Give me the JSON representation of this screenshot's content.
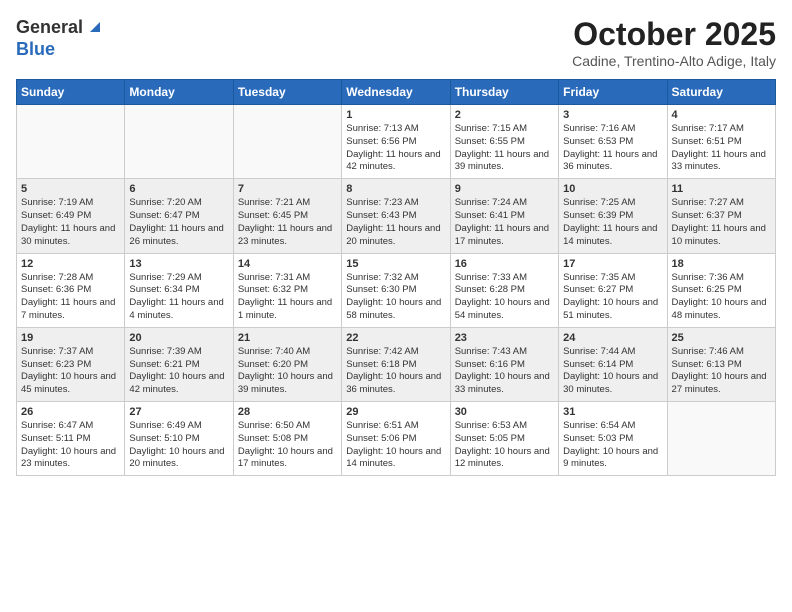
{
  "header": {
    "logo_general": "General",
    "logo_blue": "Blue",
    "month_title": "October 2025",
    "subtitle": "Cadine, Trentino-Alto Adige, Italy"
  },
  "days_of_week": [
    "Sunday",
    "Monday",
    "Tuesday",
    "Wednesday",
    "Thursday",
    "Friday",
    "Saturday"
  ],
  "weeks": [
    [
      {
        "day": "",
        "info": ""
      },
      {
        "day": "",
        "info": ""
      },
      {
        "day": "",
        "info": ""
      },
      {
        "day": "1",
        "info": "Sunrise: 7:13 AM\nSunset: 6:56 PM\nDaylight: 11 hours and 42 minutes."
      },
      {
        "day": "2",
        "info": "Sunrise: 7:15 AM\nSunset: 6:55 PM\nDaylight: 11 hours and 39 minutes."
      },
      {
        "day": "3",
        "info": "Sunrise: 7:16 AM\nSunset: 6:53 PM\nDaylight: 11 hours and 36 minutes."
      },
      {
        "day": "4",
        "info": "Sunrise: 7:17 AM\nSunset: 6:51 PM\nDaylight: 11 hours and 33 minutes."
      }
    ],
    [
      {
        "day": "5",
        "info": "Sunrise: 7:19 AM\nSunset: 6:49 PM\nDaylight: 11 hours and 30 minutes."
      },
      {
        "day": "6",
        "info": "Sunrise: 7:20 AM\nSunset: 6:47 PM\nDaylight: 11 hours and 26 minutes."
      },
      {
        "day": "7",
        "info": "Sunrise: 7:21 AM\nSunset: 6:45 PM\nDaylight: 11 hours and 23 minutes."
      },
      {
        "day": "8",
        "info": "Sunrise: 7:23 AM\nSunset: 6:43 PM\nDaylight: 11 hours and 20 minutes."
      },
      {
        "day": "9",
        "info": "Sunrise: 7:24 AM\nSunset: 6:41 PM\nDaylight: 11 hours and 17 minutes."
      },
      {
        "day": "10",
        "info": "Sunrise: 7:25 AM\nSunset: 6:39 PM\nDaylight: 11 hours and 14 minutes."
      },
      {
        "day": "11",
        "info": "Sunrise: 7:27 AM\nSunset: 6:37 PM\nDaylight: 11 hours and 10 minutes."
      }
    ],
    [
      {
        "day": "12",
        "info": "Sunrise: 7:28 AM\nSunset: 6:36 PM\nDaylight: 11 hours and 7 minutes."
      },
      {
        "day": "13",
        "info": "Sunrise: 7:29 AM\nSunset: 6:34 PM\nDaylight: 11 hours and 4 minutes."
      },
      {
        "day": "14",
        "info": "Sunrise: 7:31 AM\nSunset: 6:32 PM\nDaylight: 11 hours and 1 minute."
      },
      {
        "day": "15",
        "info": "Sunrise: 7:32 AM\nSunset: 6:30 PM\nDaylight: 10 hours and 58 minutes."
      },
      {
        "day": "16",
        "info": "Sunrise: 7:33 AM\nSunset: 6:28 PM\nDaylight: 10 hours and 54 minutes."
      },
      {
        "day": "17",
        "info": "Sunrise: 7:35 AM\nSunset: 6:27 PM\nDaylight: 10 hours and 51 minutes."
      },
      {
        "day": "18",
        "info": "Sunrise: 7:36 AM\nSunset: 6:25 PM\nDaylight: 10 hours and 48 minutes."
      }
    ],
    [
      {
        "day": "19",
        "info": "Sunrise: 7:37 AM\nSunset: 6:23 PM\nDaylight: 10 hours and 45 minutes."
      },
      {
        "day": "20",
        "info": "Sunrise: 7:39 AM\nSunset: 6:21 PM\nDaylight: 10 hours and 42 minutes."
      },
      {
        "day": "21",
        "info": "Sunrise: 7:40 AM\nSunset: 6:20 PM\nDaylight: 10 hours and 39 minutes."
      },
      {
        "day": "22",
        "info": "Sunrise: 7:42 AM\nSunset: 6:18 PM\nDaylight: 10 hours and 36 minutes."
      },
      {
        "day": "23",
        "info": "Sunrise: 7:43 AM\nSunset: 6:16 PM\nDaylight: 10 hours and 33 minutes."
      },
      {
        "day": "24",
        "info": "Sunrise: 7:44 AM\nSunset: 6:14 PM\nDaylight: 10 hours and 30 minutes."
      },
      {
        "day": "25",
        "info": "Sunrise: 7:46 AM\nSunset: 6:13 PM\nDaylight: 10 hours and 27 minutes."
      }
    ],
    [
      {
        "day": "26",
        "info": "Sunrise: 6:47 AM\nSunset: 5:11 PM\nDaylight: 10 hours and 23 minutes."
      },
      {
        "day": "27",
        "info": "Sunrise: 6:49 AM\nSunset: 5:10 PM\nDaylight: 10 hours and 20 minutes."
      },
      {
        "day": "28",
        "info": "Sunrise: 6:50 AM\nSunset: 5:08 PM\nDaylight: 10 hours and 17 minutes."
      },
      {
        "day": "29",
        "info": "Sunrise: 6:51 AM\nSunset: 5:06 PM\nDaylight: 10 hours and 14 minutes."
      },
      {
        "day": "30",
        "info": "Sunrise: 6:53 AM\nSunset: 5:05 PM\nDaylight: 10 hours and 12 minutes."
      },
      {
        "day": "31",
        "info": "Sunrise: 6:54 AM\nSunset: 5:03 PM\nDaylight: 10 hours and 9 minutes."
      },
      {
        "day": "",
        "info": ""
      }
    ]
  ]
}
